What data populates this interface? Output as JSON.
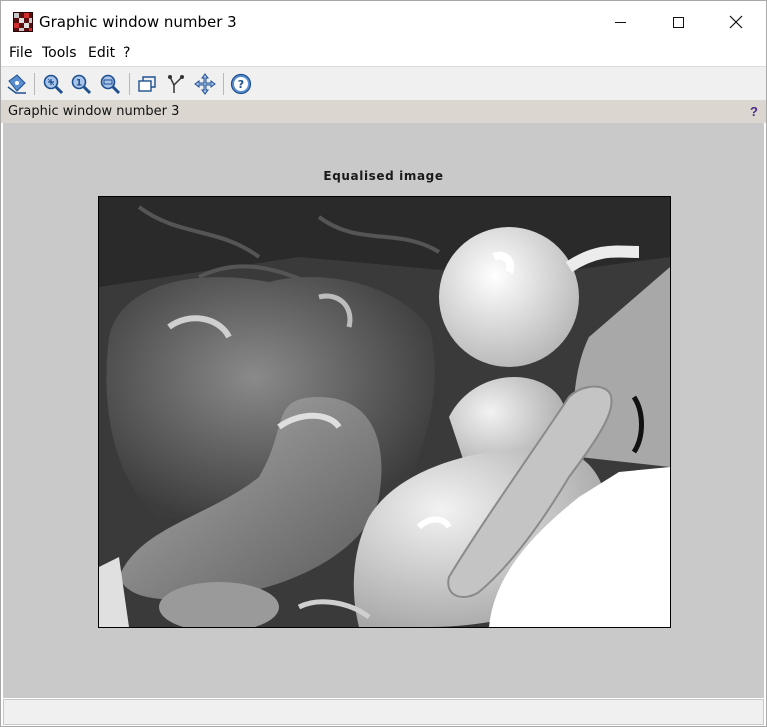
{
  "window": {
    "title": "Graphic window number 3"
  },
  "title_bar_buttons": {
    "minimize": "minimize",
    "maximize": "maximize",
    "close": "close"
  },
  "menu": {
    "file": "File",
    "tools": "Tools",
    "edit": "Edit",
    "help": "?"
  },
  "toolbar": {
    "icons": [
      "datatip-icon",
      "zoom-in-icon",
      "zoom-original-icon",
      "zoom-out-icon",
      "rotate-3d-icon",
      "select-tree-icon",
      "pan-icon",
      "help-icon"
    ]
  },
  "info": {
    "text": "Graphic window number 3",
    "help": "?"
  },
  "plot": {
    "title": "Equalised image",
    "image_description_colors": {
      "background": "#c9c9c9",
      "frame": "#000000"
    }
  }
}
